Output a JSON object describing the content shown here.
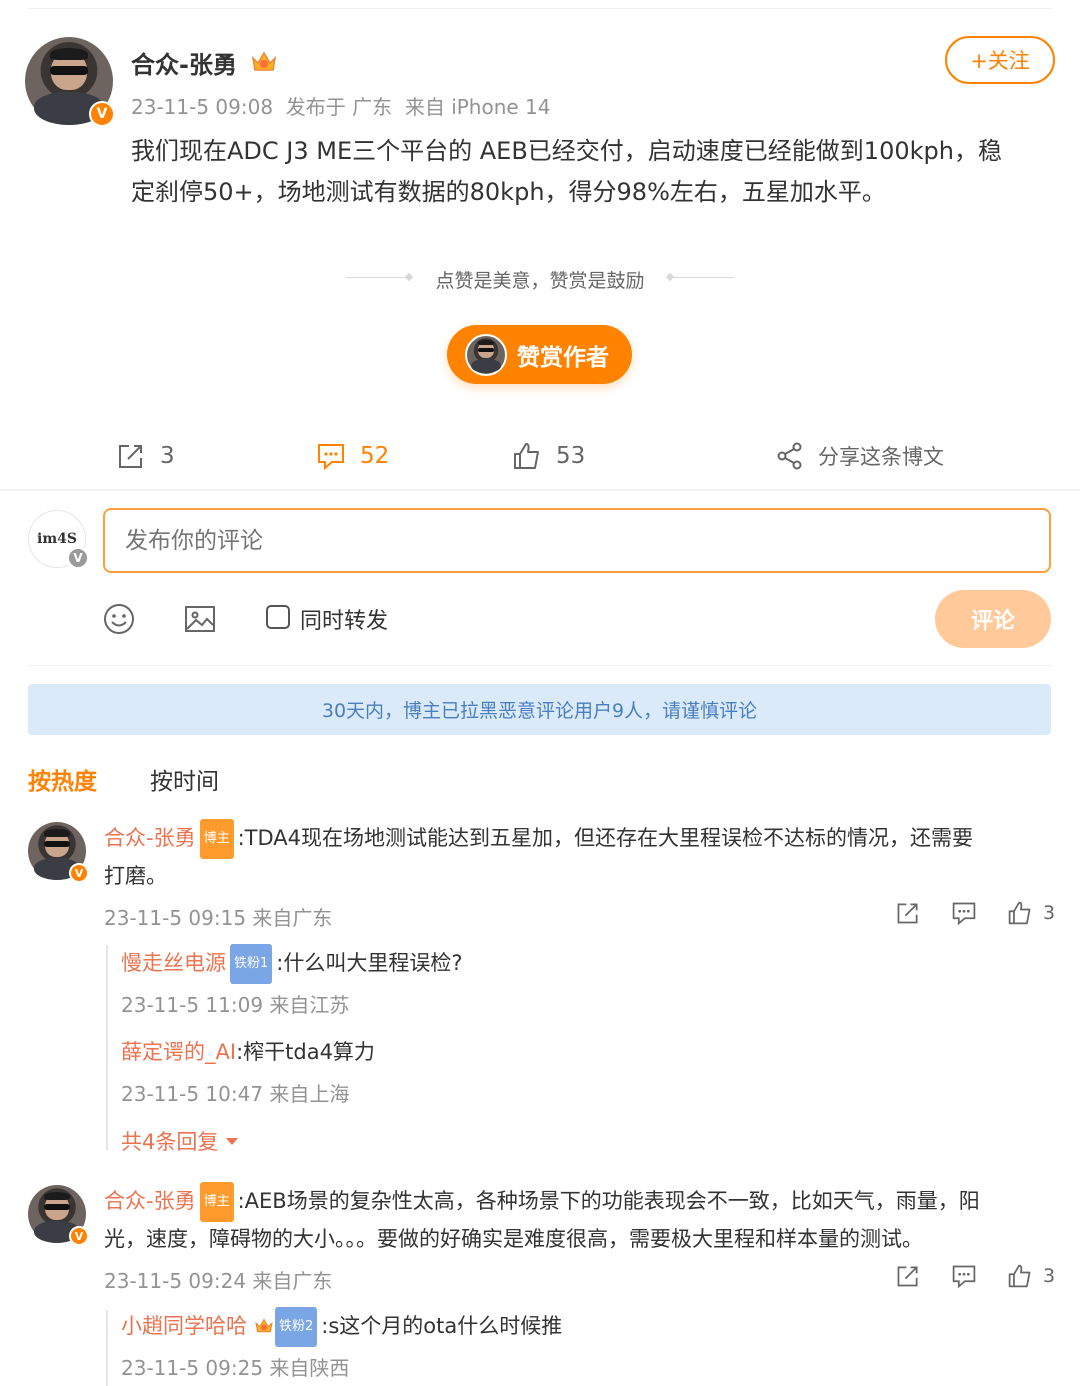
{
  "post": {
    "author": "合众-张勇",
    "meta": "23-11-5 09:08  发布于 广东  来自 iPhone 14",
    "follow_label": "+关注",
    "text_line1": "我们现在ADC J3 ME三个平台的 AEB已经交付，启动速度已经能做到100kph，稳",
    "text_line2": "定刹停50+，场地测试有数据的80kph，得分98%左右，五星加水平。",
    "reward_tip": "点赞是美意，赞赏是鼓励",
    "reward_button": "赞赏作者"
  },
  "actions": {
    "repost_count": "3",
    "comment_count": "52",
    "like_count": "53",
    "share_label": "分享这条博文"
  },
  "composer": {
    "avatar_text": "im4S",
    "placeholder": "发布你的评论",
    "also_repost_label": "同时转发",
    "submit_label": "评论"
  },
  "notice": "30天内，博主已拉黑恶意评论用户9人，请谨慎评论",
  "sort_tabs": {
    "hot": "按热度",
    "time": "按时间"
  },
  "colors": {
    "accent": "#ff8200",
    "name": "#eb7350",
    "notice_bg": "#dbeaf8"
  },
  "comments": [
    {
      "author": "合众-张勇",
      "tag": "博主",
      "text_line1": ":TDA4现在场地测试能达到五星加，但还存在大里程误检不达标的情况，还需要",
      "text_line2": "打磨。",
      "meta": "23-11-5 09:15 来自广东",
      "likes": "3",
      "replies": [
        {
          "author": "慢走丝电源",
          "tag": "铁粉1",
          "text": ":什么叫大里程误检?",
          "meta": "23-11-5 11:09 来自江苏"
        },
        {
          "author": "薛定谔的_AI",
          "text": ":榨干tda4算力",
          "meta": "23-11-5 10:47 来自上海"
        }
      ],
      "more_replies": "共4条回复"
    },
    {
      "author": "合众-张勇",
      "tag": "博主",
      "text_line1": ":AEB场景的复杂性太高，各种场景下的功能表现会不一致，比如天气，雨量，阳",
      "text_line2": "光，速度，障碍物的大小。。。要做的好确实是难度很高，需要极大里程和样本量的测试。",
      "meta": "23-11-5 09:24 来自广东",
      "likes": "3",
      "replies": [
        {
          "author": "小趙同学哈哈",
          "tag": "铁粉2",
          "text": ":s这个月的ota什么时候推",
          "meta": "23-11-5 09:25 来自陕西"
        }
      ]
    }
  ]
}
